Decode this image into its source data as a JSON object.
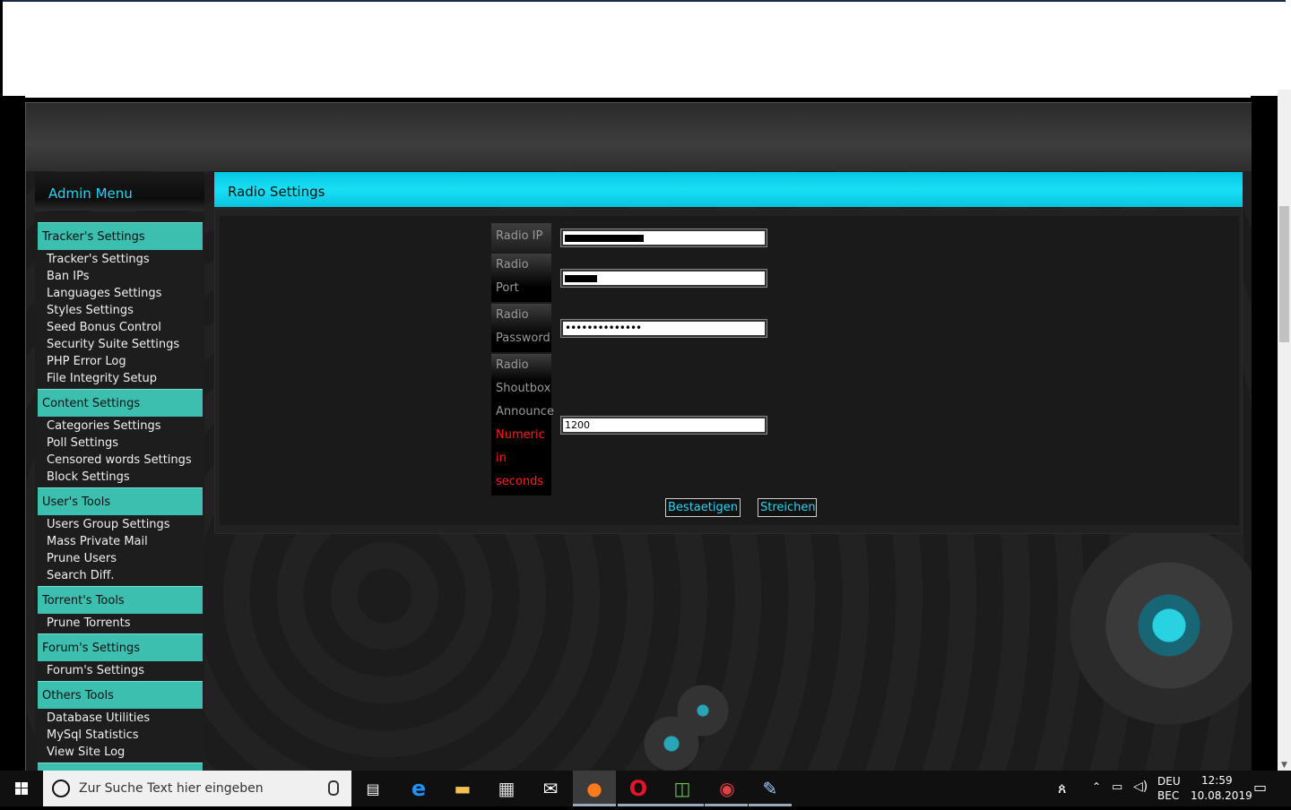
{
  "admin_menu": {
    "title": "Admin Menu",
    "sections": [
      {
        "label": "Tracker's Settings",
        "links": [
          "Tracker's Settings",
          "Ban IPs",
          "Languages Settings",
          "Styles Settings",
          "Seed Bonus Control",
          "Security Suite Settings",
          "PHP Error Log",
          "File Integrity Setup"
        ]
      },
      {
        "label": "Content Settings",
        "links": [
          "Categories Settings",
          "Poll Settings",
          "Censored words Settings",
          "Block Settings"
        ]
      },
      {
        "label": "User's Tools",
        "links": [
          "Users Group Settings",
          "Mass Private Mail",
          "Prune Users",
          "Search Diff."
        ]
      },
      {
        "label": "Torrent's Tools",
        "links": [
          "Prune Torrents"
        ]
      },
      {
        "label": "Forum's Settings",
        "links": [
          "Forum's Settings"
        ]
      },
      {
        "label": "Others Tools",
        "links": [
          "Database Utilities",
          "MySql Statistics",
          "View Site Log"
        ]
      }
    ]
  },
  "panel": {
    "title": "Radio Settings",
    "fields": {
      "radio_ip_label": "Radio IP",
      "radio_port_label": [
        "Radio",
        "Port"
      ],
      "radio_password_label": [
        "Radio",
        "Password"
      ],
      "radio_password_value": "••••••••••••••",
      "shoutbox_label": [
        "Radio",
        "Shoutbox",
        "Announce"
      ],
      "shoutbox_note": [
        "Numeric",
        "in",
        "seconds"
      ],
      "shoutbox_value": "1200"
    },
    "buttons": {
      "confirm": "Bestaetigen",
      "cancel": "Streichen"
    }
  },
  "taskbar": {
    "search_placeholder": "Zur Suche Text hier eingeben",
    "lang_top": "DEU",
    "lang_bottom": "BEC",
    "time": "12:59",
    "date": "10.08.2019"
  },
  "colors": {
    "accent": "#27d6f2",
    "section": "#3dbfb0",
    "header": "#18e0f5",
    "note": "#ff1e1e"
  }
}
